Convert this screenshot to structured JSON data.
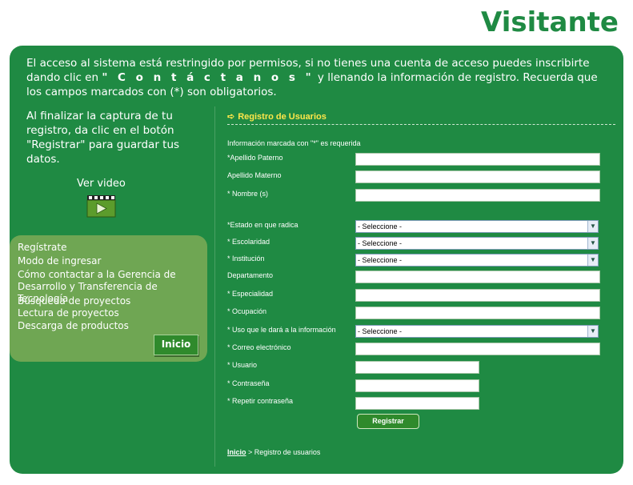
{
  "page": {
    "title": "Visitante"
  },
  "intro": {
    "text_before": "El acceso al sistema está restringido por permisos, si no tienes una cuenta de acceso puedes inscribirte dando clic en ",
    "contact_link": "\" C o n t á c t a n o s \"",
    "text_after": " y llenando la información de registro. Recuerda que los campos marcados con (*) son obligatorios."
  },
  "left_note": "Al finalizar la captura de tu registro, da clic en el botón \"Registrar\" para guardar tus datos.",
  "video": {
    "label": "Ver video",
    "icon": "video-clapper-icon"
  },
  "menu": {
    "items": [
      "Regístrate",
      "Modo de ingresar",
      "Cómo contactar a la Gerencia de Desarrollo y Transferencia de Tecnología",
      "Búsqueda de proyectos",
      "Lectura de proyectos",
      "Descarga de productos"
    ],
    "home_button": "Inicio"
  },
  "form": {
    "header": "Registro de Usuarios",
    "required_note": "Información marcada con \"*\" es requerida",
    "fields": {
      "apellido_paterno": "*Apellido Paterno",
      "apellido_materno": "Apellido Materno",
      "nombre": "* Nombre (s)",
      "estado": "*Estado en que radica",
      "escolaridad": "* Escolaridad",
      "institucion": "* Institución",
      "departamento": "Departamento",
      "especialidad": "* Especialidad",
      "ocupacion": "* Ocupación",
      "uso": "* Uso que le dará a la información",
      "correo": "* Correo electrónico",
      "usuario": "* Usuario",
      "contrasena": "* Contraseña",
      "repetir": "* Repetir contraseña"
    },
    "select_default": "- Seleccione -",
    "submit": "Registrar"
  },
  "breadcrumb": {
    "home": "Inicio",
    "separator": " > ",
    "current": "Registro de usuarios"
  },
  "colors": {
    "brand_green": "#1f8a43",
    "menu_green": "#6fa653",
    "header_yellow": "#ffe74a"
  }
}
